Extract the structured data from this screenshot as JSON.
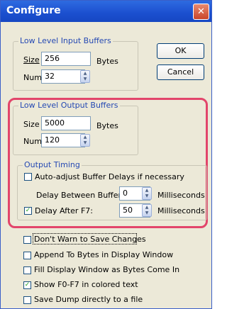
{
  "title": "Configure",
  "close_glyph": "✕",
  "input_buffers": {
    "legend": "Low Level Input Buffers",
    "size_label": "Size",
    "size_value": "256",
    "size_unit": "Bytes",
    "num_label": "Num",
    "num_value": "32"
  },
  "buttons": {
    "ok": "OK",
    "cancel": "Cancel"
  },
  "output_buffers": {
    "legend": "Low Level Output Buffers",
    "size_label": "Size",
    "size_value": "5000",
    "size_unit": "Bytes",
    "num_label": "Num",
    "num_value": "120"
  },
  "output_timing": {
    "legend": "Output Timing",
    "auto_adjust": "Auto-adjust Buffer Delays if necessary",
    "auto_adjust_checked": false,
    "delay_between_label": "Delay Between Buffers:",
    "delay_between_value": "0",
    "delay_between_unit": "Milliseconds",
    "delay_after_label": "Delay After F7:",
    "delay_after_value": "50",
    "delay_after_unit": "Milliseconds",
    "delay_after_checked": true
  },
  "options": [
    {
      "label": "Don't Warn to Save Changes",
      "checked": false
    },
    {
      "label": "Append To Bytes in Display Window",
      "checked": false
    },
    {
      "label": "Fill Display Window as Bytes Come In",
      "checked": false
    },
    {
      "label": "Show F0-F7 in colored text",
      "checked": true
    },
    {
      "label": "Save Dump directly to a file",
      "checked": false
    }
  ],
  "colors": {
    "titlebar": "#1b4fcf",
    "highlight": "#e2456b",
    "legend_text": "#2549b3"
  }
}
